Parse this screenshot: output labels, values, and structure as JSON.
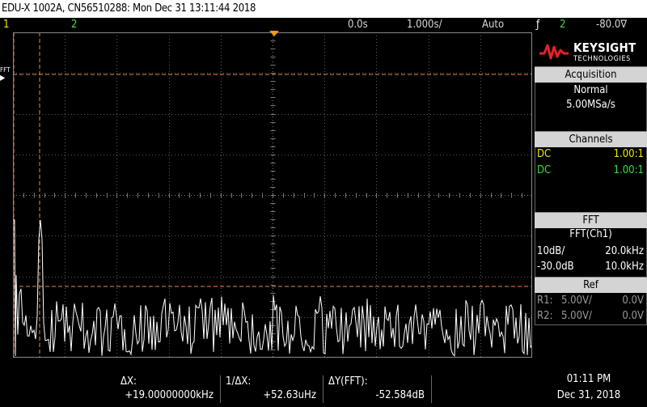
{
  "title": "EDU-X 1002A, CN56510288: Mon Dec 31 13:11:44 2018",
  "status": {
    "ch1_num": "1",
    "ch2_num": "2",
    "time_offset": "0.0s",
    "timebase": "1.000s/",
    "trigger_mode": "Auto",
    "trig_icon": "ƒ",
    "trig_source": "2",
    "trig_level": "-80.0∇"
  },
  "brand": {
    "name": "KEYSIGHT",
    "sub": "TECHNOLOGIES"
  },
  "acquisition": {
    "header": "Acquisition",
    "mode": "Normal",
    "rate": "5.00MSa/s"
  },
  "channels": {
    "header": "Channels",
    "rows": [
      {
        "coupling": "DC",
        "probe": "1.00:1"
      },
      {
        "coupling": "DC",
        "probe": "1.00:1"
      }
    ]
  },
  "fft": {
    "header": "FFT",
    "source": "FFT(Ch1)",
    "scale": "10dB/",
    "span": "20.0kHz",
    "ref_level": "-30.0dB",
    "center": "10.0kHz"
  },
  "ref": {
    "header": "Ref",
    "rows": [
      {
        "label": "R1:",
        "scale": "5.00V/",
        "offset": "0.0V"
      },
      {
        "label": "R2:",
        "scale": "5.00V/",
        "offset": "0.0V"
      }
    ]
  },
  "screen_label": "FFT",
  "measurements": {
    "dx_label": "ΔX:",
    "dx_value": "+19.00000000kHz",
    "inv_dx_label": "1/ΔX:",
    "inv_dx_value": "+52.63uHz",
    "dy_label": "ΔY(FFT):",
    "dy_value": "-52.584dB"
  },
  "clock": {
    "time": "01:11 PM",
    "date": "Dec 31, 2018"
  },
  "colors": {
    "ch1": "#f2e600",
    "ch2": "#3adf3a",
    "cursor": "#e8864a",
    "panel_header": "#d4d4d4"
  }
}
